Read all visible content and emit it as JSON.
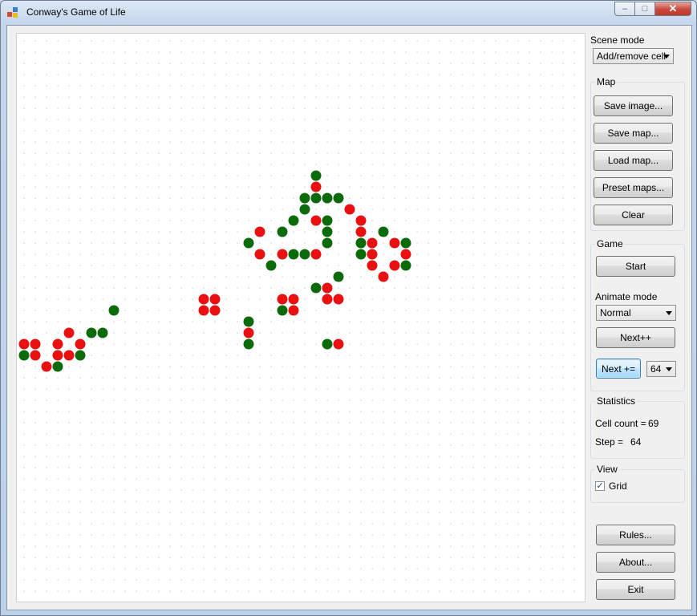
{
  "window": {
    "title": "Conway's Game of Life",
    "minimize_label": "–",
    "maximize_label": "□",
    "close_label": "✕"
  },
  "colors": {
    "live_cell": "#e81010",
    "mature_cell": "#0b6b0b",
    "grid_dot": "#c4c4c4"
  },
  "scene_mode": {
    "label": "Scene mode",
    "selected": "Add/remove cell"
  },
  "map": {
    "title": "Map",
    "save_image": "Save image...",
    "save_map": "Save map...",
    "load_map": "Load map...",
    "preset_maps": "Preset maps...",
    "clear": "Clear"
  },
  "game": {
    "title": "Game",
    "start": "Start",
    "animate_mode_label": "Animate mode",
    "animate_mode_selected": "Normal",
    "next_plus_plus": "Next++",
    "next_plus_eq": "Next +=",
    "step_amount": "64"
  },
  "statistics": {
    "title": "Statistics",
    "cell_count_label": "Cell count =",
    "cell_count": "69",
    "step_label": "Step =",
    "step": "64"
  },
  "view": {
    "title": "View",
    "grid_label": "Grid",
    "grid_checked": true
  },
  "footer_buttons": {
    "rules": "Rules...",
    "about": "About...",
    "exit": "Exit"
  },
  "board": {
    "cells": [
      {
        "col": 26,
        "row": 12,
        "state": "g"
      },
      {
        "col": 26,
        "row": 13,
        "state": "r"
      },
      {
        "col": 25,
        "row": 14,
        "state": "g"
      },
      {
        "col": 26,
        "row": 14,
        "state": "g"
      },
      {
        "col": 27,
        "row": 14,
        "state": "g"
      },
      {
        "col": 28,
        "row": 14,
        "state": "g"
      },
      {
        "col": 25,
        "row": 15,
        "state": "g"
      },
      {
        "col": 29,
        "row": 15,
        "state": "r"
      },
      {
        "col": 24,
        "row": 16,
        "state": "g"
      },
      {
        "col": 26,
        "row": 16,
        "state": "r"
      },
      {
        "col": 27,
        "row": 16,
        "state": "g"
      },
      {
        "col": 30,
        "row": 16,
        "state": "r"
      },
      {
        "col": 21,
        "row": 17,
        "state": "r"
      },
      {
        "col": 23,
        "row": 17,
        "state": "g"
      },
      {
        "col": 27,
        "row": 17,
        "state": "g"
      },
      {
        "col": 30,
        "row": 17,
        "state": "r"
      },
      {
        "col": 32,
        "row": 17,
        "state": "g"
      },
      {
        "col": 20,
        "row": 18,
        "state": "g"
      },
      {
        "col": 27,
        "row": 18,
        "state": "g"
      },
      {
        "col": 30,
        "row": 18,
        "state": "g"
      },
      {
        "col": 31,
        "row": 18,
        "state": "r"
      },
      {
        "col": 33,
        "row": 18,
        "state": "r"
      },
      {
        "col": 34,
        "row": 18,
        "state": "g"
      },
      {
        "col": 21,
        "row": 19,
        "state": "r"
      },
      {
        "col": 23,
        "row": 19,
        "state": "r"
      },
      {
        "col": 24,
        "row": 19,
        "state": "g"
      },
      {
        "col": 25,
        "row": 19,
        "state": "g"
      },
      {
        "col": 26,
        "row": 19,
        "state": "r"
      },
      {
        "col": 30,
        "row": 19,
        "state": "g"
      },
      {
        "col": 31,
        "row": 19,
        "state": "r"
      },
      {
        "col": 34,
        "row": 19,
        "state": "r"
      },
      {
        "col": 22,
        "row": 20,
        "state": "g"
      },
      {
        "col": 31,
        "row": 20,
        "state": "r"
      },
      {
        "col": 33,
        "row": 20,
        "state": "r"
      },
      {
        "col": 34,
        "row": 20,
        "state": "g"
      },
      {
        "col": 28,
        "row": 21,
        "state": "g"
      },
      {
        "col": 32,
        "row": 21,
        "state": "r"
      },
      {
        "col": 26,
        "row": 22,
        "state": "g"
      },
      {
        "col": 27,
        "row": 22,
        "state": "r"
      },
      {
        "col": 16,
        "row": 23,
        "state": "r"
      },
      {
        "col": 17,
        "row": 23,
        "state": "r"
      },
      {
        "col": 23,
        "row": 23,
        "state": "r"
      },
      {
        "col": 24,
        "row": 23,
        "state": "r"
      },
      {
        "col": 27,
        "row": 23,
        "state": "r"
      },
      {
        "col": 28,
        "row": 23,
        "state": "r"
      },
      {
        "col": 8,
        "row": 24,
        "state": "g"
      },
      {
        "col": 16,
        "row": 24,
        "state": "r"
      },
      {
        "col": 17,
        "row": 24,
        "state": "r"
      },
      {
        "col": 23,
        "row": 24,
        "state": "g"
      },
      {
        "col": 24,
        "row": 24,
        "state": "r"
      },
      {
        "col": 20,
        "row": 25,
        "state": "g"
      },
      {
        "col": 4,
        "row": 26,
        "state": "r"
      },
      {
        "col": 6,
        "row": 26,
        "state": "g"
      },
      {
        "col": 7,
        "row": 26,
        "state": "g"
      },
      {
        "col": 20,
        "row": 26,
        "state": "r"
      },
      {
        "col": 0,
        "row": 27,
        "state": "r"
      },
      {
        "col": 1,
        "row": 27,
        "state": "r"
      },
      {
        "col": 3,
        "row": 27,
        "state": "r"
      },
      {
        "col": 5,
        "row": 27,
        "state": "r"
      },
      {
        "col": 20,
        "row": 27,
        "state": "g"
      },
      {
        "col": 27,
        "row": 27,
        "state": "g"
      },
      {
        "col": 28,
        "row": 27,
        "state": "r"
      },
      {
        "col": 0,
        "row": 28,
        "state": "g"
      },
      {
        "col": 1,
        "row": 28,
        "state": "r"
      },
      {
        "col": 3,
        "row": 28,
        "state": "r"
      },
      {
        "col": 4,
        "row": 28,
        "state": "r"
      },
      {
        "col": 5,
        "row": 28,
        "state": "g"
      },
      {
        "col": 2,
        "row": 29,
        "state": "r"
      },
      {
        "col": 3,
        "row": 29,
        "state": "g"
      }
    ]
  }
}
